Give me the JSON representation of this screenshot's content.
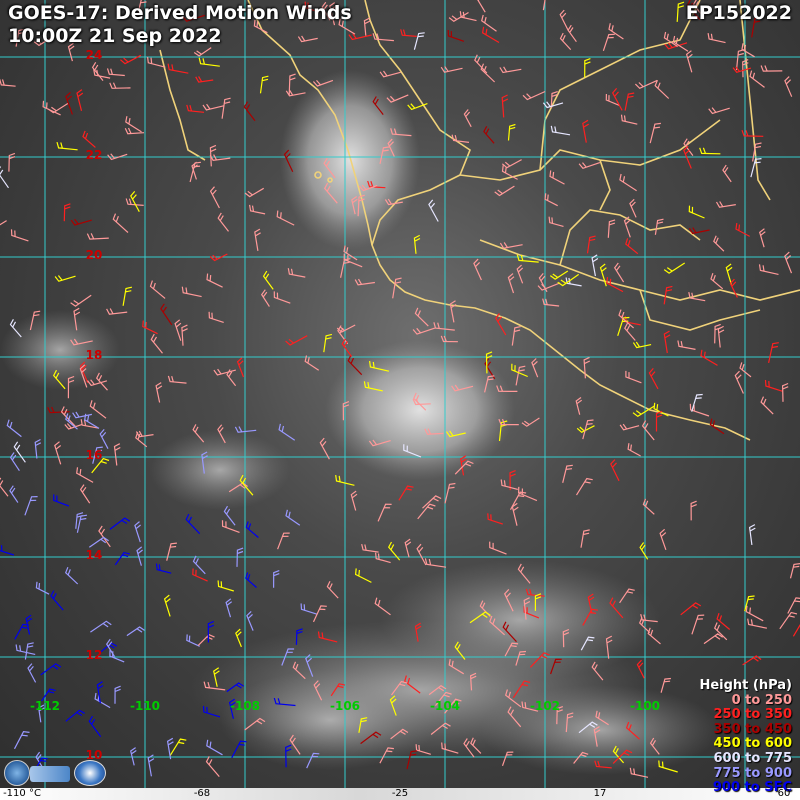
{
  "header": {
    "title": "GOES-17: Derived Motion Winds",
    "datetime": "10:00Z 21 Sep 2022",
    "storm_id": "EP152022"
  },
  "grid": {
    "lat_labels": [
      "24",
      "22",
      "20",
      "18",
      "16",
      "14",
      "12",
      "10"
    ],
    "lon_labels": [
      "-112",
      "-110",
      "-108",
      "-106",
      "-104",
      "-102",
      "-100"
    ],
    "lat_label_color": "#cc0000",
    "lon_label_color": "#00cc00",
    "grid_color": "#33cccc"
  },
  "legend": {
    "title": "Height (hPa)",
    "levels": [
      {
        "label": "0 to 250",
        "color": "#ff9999"
      },
      {
        "label": "250 to 350",
        "color": "#ff2020"
      },
      {
        "label": "350 to 450",
        "color": "#aa0000"
      },
      {
        "label": "450 to 600",
        "color": "#ffff00"
      },
      {
        "label": "600 to 775",
        "color": "#e6e6ff"
      },
      {
        "label": "775 to 900",
        "color": "#9999ff"
      },
      {
        "label": "900 to SFC",
        "color": "#0000ee"
      }
    ]
  },
  "colorbar": {
    "labels": [
      "-110 °C",
      "-68",
      "-25",
      "17",
      "60"
    ]
  },
  "logos": [
    "cira-logo",
    "noaa-logo"
  ]
}
